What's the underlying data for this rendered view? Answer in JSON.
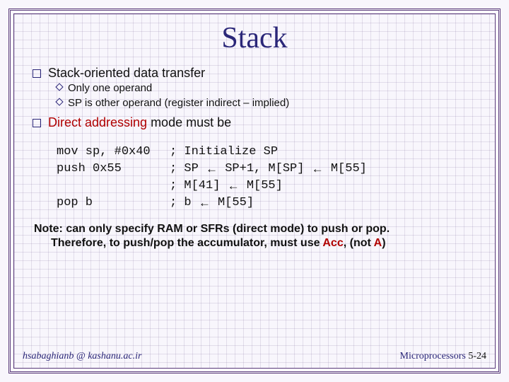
{
  "title": "Stack",
  "bullets": [
    {
      "text": "Stack-oriented data transfer",
      "sub": [
        "Only one operand",
        "SP is other operand (register indirect – implied)"
      ]
    },
    {
      "text_prefix": "",
      "red": "Direct addressing",
      "text_suffix": " mode must be",
      "sub": []
    }
  ],
  "code": [
    {
      "instr": "mov sp, #0x40",
      "comment_parts": [
        "; Initialize SP"
      ]
    },
    {
      "instr": "push 0x55",
      "comment_parts": [
        "; SP ",
        "←",
        " SP+1, M[SP] ",
        "←",
        " M[55]"
      ]
    },
    {
      "instr": "",
      "comment_parts": [
        "; M[41] ",
        "←",
        " M[55]"
      ]
    },
    {
      "instr": "pop b",
      "comment_parts": [
        "; b ",
        "←",
        " M[55]"
      ]
    }
  ],
  "note": {
    "line1_a": "Note: can only specify RAM or SFRs (direct mode) to push or pop.",
    "line2_a": "Therefore, to push/pop the accumulator, must use ",
    "acc": "Acc",
    "mid": ", (not ",
    "a": "A",
    "end": ")"
  },
  "footer": {
    "left": "hsabaghianb @ kashanu.ac.ir",
    "right_label": "Microprocessors ",
    "right_page": "5-24"
  }
}
